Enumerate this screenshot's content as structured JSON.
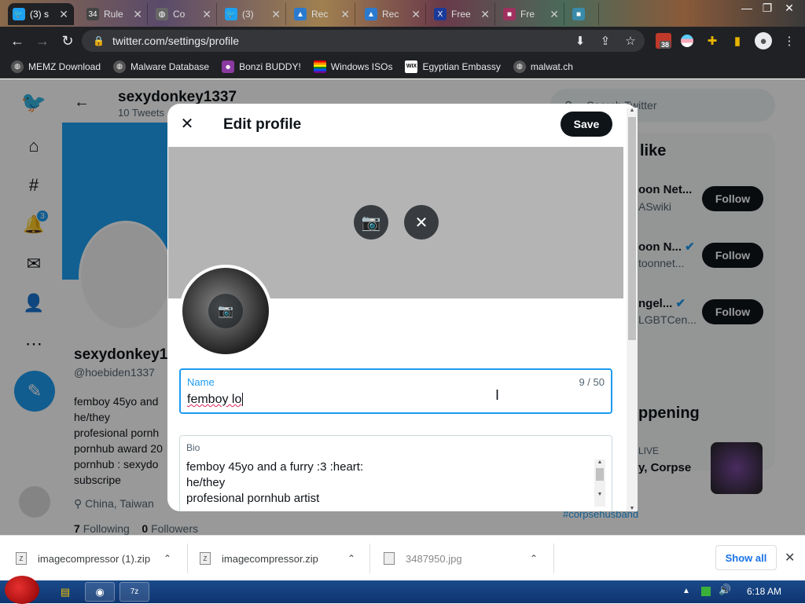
{
  "browser": {
    "tabs": [
      {
        "label": "(3) s",
        "icon": "twitter-icon",
        "color": "#1da1f2"
      },
      {
        "label": "Rule",
        "icon": "site-icon",
        "color": "#444"
      },
      {
        "label": "Co",
        "icon": "globe-icon",
        "color": "#666"
      },
      {
        "label": "(3)",
        "icon": "twitter-icon",
        "color": "#1da1f2"
      },
      {
        "label": "Rec",
        "icon": "triangle-icon",
        "color": "#2a7ad0"
      },
      {
        "label": "Rec",
        "icon": "triangle-icon",
        "color": "#2a7ad0"
      },
      {
        "label": "Free",
        "icon": "x-icon",
        "color": "#1a3a9a"
      },
      {
        "label": "Fre",
        "icon": "site-icon",
        "color": "#a03060"
      },
      {
        "label": "",
        "icon": "site-icon",
        "color": "#3a8aaa"
      }
    ],
    "url": "twitter.com/settings/profile",
    "ext_badge": "38",
    "bookmarks": [
      {
        "label": "MEMZ Download",
        "icon": "globe-icon",
        "color": "#555"
      },
      {
        "label": "Malware Database",
        "icon": "globe-icon",
        "color": "#555"
      },
      {
        "label": "Bonzi BUDDY!",
        "icon": "bonzi-icon",
        "color": "#8a3aa0"
      },
      {
        "label": "Windows ISOs",
        "icon": "windows-icon",
        "color": "#e04040"
      },
      {
        "label": "Egyptian Embassy",
        "icon": "wix-icon",
        "color": "#000"
      },
      {
        "label": "malwat.ch",
        "icon": "globe-icon",
        "color": "#555"
      }
    ]
  },
  "twitter": {
    "header_name": "sexydonkey1337",
    "tweet_count": "10 Tweets",
    "notif_badge": "3",
    "profile_name": "sexydonkey1",
    "handle": "@hoebiden1337",
    "bio_lines": [
      "femboy 45yo and",
      "he/they",
      "profesional pornh",
      "pornhub award 20",
      "pornhub : sexydo",
      "subscripe"
    ],
    "location": "China, Taiwan",
    "following_count": "7",
    "following_label": "Following",
    "followers_count": "0",
    "followers_label": "Followers",
    "search_placeholder": "Search Twitter",
    "who_to_follow_partial": "like",
    "suggestions": [
      {
        "name": "oon Net...",
        "handle": "ASwiki",
        "verified": false,
        "button": "Follow"
      },
      {
        "name": "oon N...",
        "handle": "toonnet...",
        "verified": true,
        "button": "Follow"
      },
      {
        "name": "ngel...",
        "handle": "LGBTCen...",
        "verified": true,
        "button": "Follow"
      }
    ],
    "happening_partial": "ppening",
    "trend_live": "LIVE",
    "trend_title": "y, Corpse",
    "trend_hashtag": "#corpsehusband"
  },
  "modal": {
    "title": "Edit profile",
    "save_label": "Save",
    "name_label": "Name",
    "name_value": "femboy lo",
    "name_counter": "9 / 50",
    "bio_label": "Bio",
    "bio_lines": [
      "femboy 45yo and a furry :3 :heart:",
      "he/they",
      "profesional pornhub artist"
    ]
  },
  "downloads": {
    "items": [
      {
        "label": "imagecompressor (1).zip",
        "icon": "zip-icon"
      },
      {
        "label": "imagecompressor.zip",
        "icon": "zip-icon"
      },
      {
        "label": "3487950.jpg",
        "icon": "image-file-icon"
      }
    ],
    "show_all": "Show all"
  },
  "taskbar": {
    "clock": "6:18 AM"
  },
  "colors": {
    "twitter_blue": "#1d9bf0",
    "dark": "#0f1419"
  }
}
